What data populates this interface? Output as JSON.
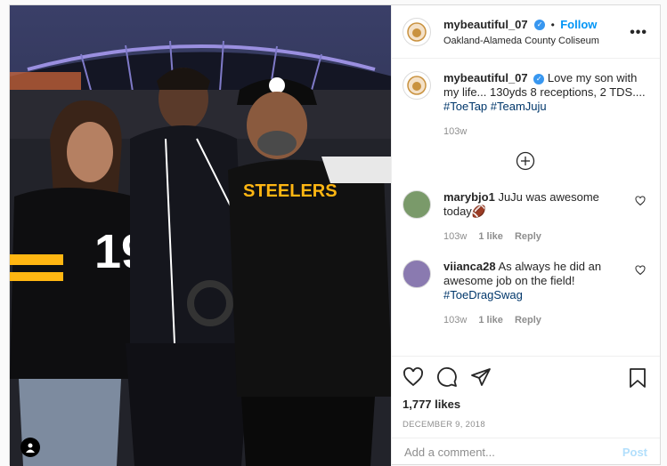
{
  "header": {
    "username": "mybeautiful_07",
    "follow_label": "Follow",
    "location": "Oakland-Alameda County Coliseum",
    "more_label": "•••"
  },
  "caption": {
    "username": "mybeautiful_07",
    "text": "Love my son with my life... 130yds 8 receptions, 2 TDS.... ",
    "hashtags": [
      "#ToeTap",
      "#TeamJuju"
    ],
    "time": "103w"
  },
  "comments": [
    {
      "username": "marybjo1",
      "text": "JuJu was awesome today🏈",
      "tags": "",
      "time": "103w",
      "likes": "1 like",
      "reply": "Reply"
    },
    {
      "username": "viianca28",
      "text": "As always he did an awesome job on the field! ",
      "tags": "#ToeDragSwag",
      "time": "103w",
      "likes": "1 like",
      "reply": "Reply"
    }
  ],
  "stats": {
    "likes": "1,777 likes",
    "date": "DECEMBER 9, 2018"
  },
  "add_comment": {
    "placeholder": "Add a comment...",
    "post_label": "Post"
  },
  "photo": {
    "jersey_number": "19",
    "shirt_text": "STEELERS"
  },
  "colors": {
    "link_blue": "#0095f6",
    "hashtag": "#00376b",
    "verified": "#3897f0",
    "steelers_gold": "#ffb612"
  }
}
